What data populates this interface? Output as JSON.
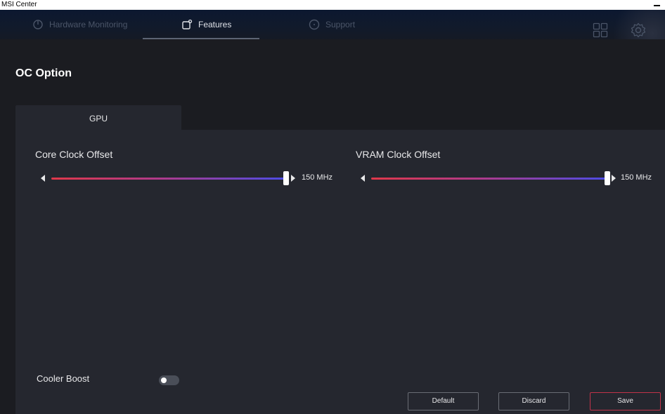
{
  "window": {
    "title": "MSI Center"
  },
  "nav": {
    "tabs": [
      {
        "label": "Hardware Monitoring",
        "icon": "power-icon",
        "active": false
      },
      {
        "label": "Features",
        "icon": "features-icon",
        "active": true
      },
      {
        "label": "Support",
        "icon": "support-icon",
        "active": false
      }
    ],
    "grid_icon": "grid-icon",
    "settings_icon": "gear-icon"
  },
  "page": {
    "title": "OC Option"
  },
  "subtabs": [
    {
      "label": "GPU",
      "active": true
    }
  ],
  "sliders": [
    {
      "label": "Core Clock Offset",
      "value": "150 MHz",
      "position_fraction": 1.0
    },
    {
      "label": "VRAM Clock Offset",
      "value": "150 MHz",
      "position_fraction": 1.0
    }
  ],
  "cooler_boost": {
    "label": "Cooler Boost",
    "enabled": false
  },
  "buttons": {
    "default": "Default",
    "discard": "Discard",
    "save": "Save"
  },
  "colors": {
    "accent_red": "#e0384a",
    "accent_blue": "#4a4ce8",
    "save_border": "#c2334a",
    "background": "#1b1c21",
    "panel": "#25272f"
  }
}
